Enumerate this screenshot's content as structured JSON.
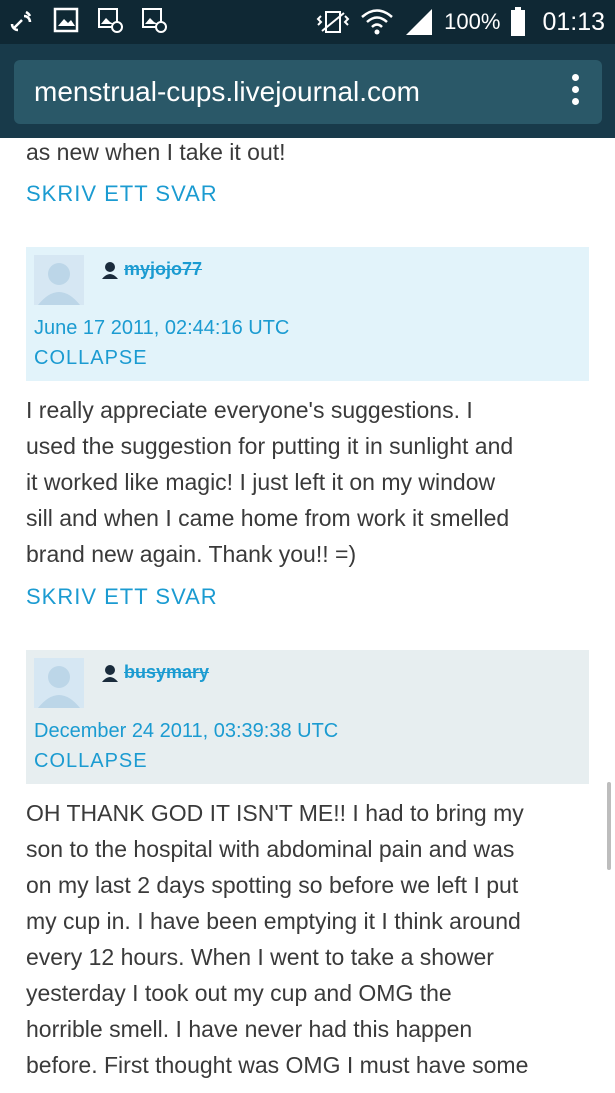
{
  "status_bar": {
    "battery": "100%",
    "time": "01:13",
    "icons": [
      "link-icon",
      "image-icon",
      "image-at-icon",
      "image-at-icon",
      "vibrate-icon",
      "wifi-icon",
      "signal-icon",
      "battery-icon"
    ]
  },
  "browser": {
    "url": "menstrual-cups.livejournal.com",
    "menu_icon": "more-vert-icon"
  },
  "comments": {
    "top_fragment": "as new when I take it out!",
    "reply_label_1": "SKRIV ETT SVAR",
    "c1": {
      "username": "myjojo77",
      "date": "June 17 2011, 02:44:16 UTC",
      "collapse": "COLLAPSE",
      "lines": [
        "I really appreciate everyone's suggestions. I",
        "used the suggestion for putting it in sunlight and",
        "it worked like magic! I just left it on my window",
        "sill and when I came home from work it smelled",
        "brand new again. Thank you!! =)"
      ],
      "reply": "SKRIV ETT SVAR"
    },
    "c2": {
      "username": "busymary",
      "date": "December 24 2011, 03:39:38 UTC",
      "collapse": "COLLAPSE",
      "lines": [
        "OH THANK GOD IT ISN'T ME!! I had to bring my",
        "son to the hospital with abdominal pain and was",
        "on my last 2 days spotting so before we left I put",
        "my cup in. I have been emptying it I think around",
        "every 12 hours. When I went to take a shower",
        "yesterday I took out my cup and OMG the",
        "horrible smell. I have never had this happen",
        "before. First thought was OMG I must have some"
      ]
    }
  },
  "colors": {
    "link": "#1b9bd1",
    "header_blue": "#e2f3fa",
    "header_grey": "#e7eef0",
    "urlbar": "#183a4a"
  }
}
